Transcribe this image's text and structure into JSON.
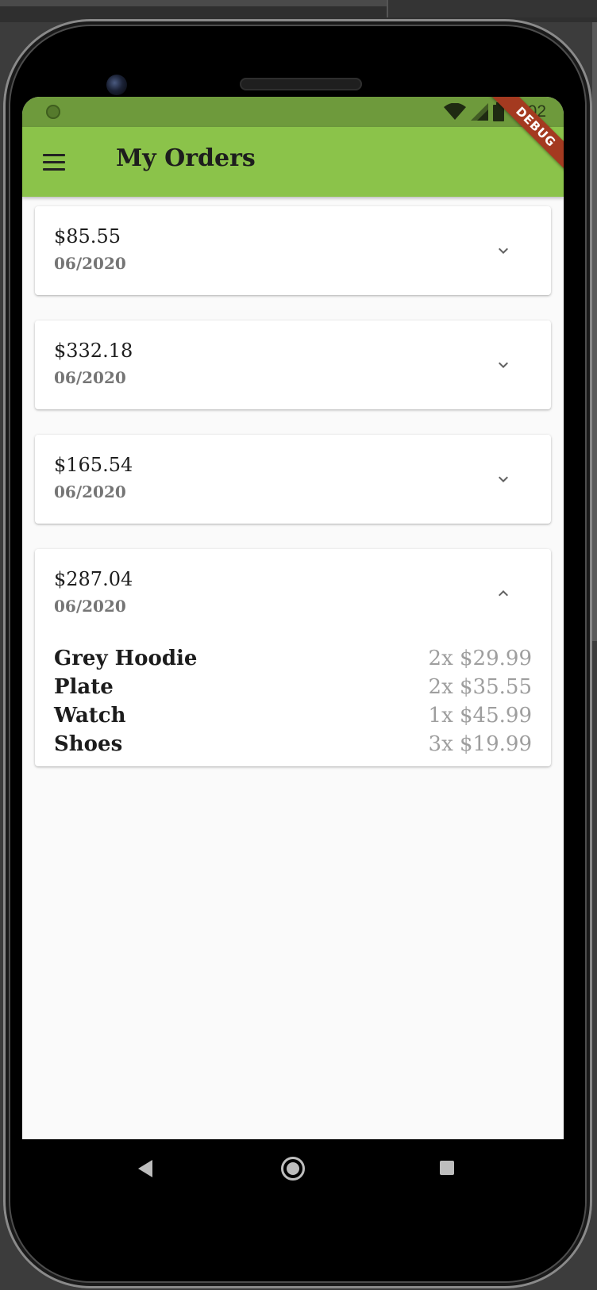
{
  "status_bar": {
    "time": "7:02",
    "bar_color": "#6e9a3c"
  },
  "app_bar": {
    "title": "My Orders",
    "menu_icon": "hamburger-menu-icon",
    "color": "#8bc34a"
  },
  "debug_banner": {
    "label": "DEBUG",
    "color": "#a43a20"
  },
  "orders": [
    {
      "amount": "$85.55",
      "date": "06/2020",
      "expanded": false,
      "toggle_icon": "chevron-down-icon"
    },
    {
      "amount": "$332.18",
      "date": "06/2020",
      "expanded": false,
      "toggle_icon": "chevron-down-icon"
    },
    {
      "amount": "$165.54",
      "date": "06/2020",
      "expanded": false,
      "toggle_icon": "chevron-down-icon"
    },
    {
      "amount": "$287.04",
      "date": "06/2020",
      "expanded": true,
      "toggle_icon": "chevron-up-icon",
      "items": [
        {
          "name": "Grey Hoodie",
          "quantity_price": "2x $29.99"
        },
        {
          "name": "Plate",
          "quantity_price": "2x $35.55"
        },
        {
          "name": "Watch",
          "quantity_price": "1x $45.99"
        },
        {
          "name": "Shoes",
          "quantity_price": "3x $19.99"
        }
      ]
    }
  ],
  "nav_bar": {
    "back_icon": "back-triangle-icon",
    "home_icon": "home-circle-icon",
    "recents_icon": "recents-square-icon"
  }
}
